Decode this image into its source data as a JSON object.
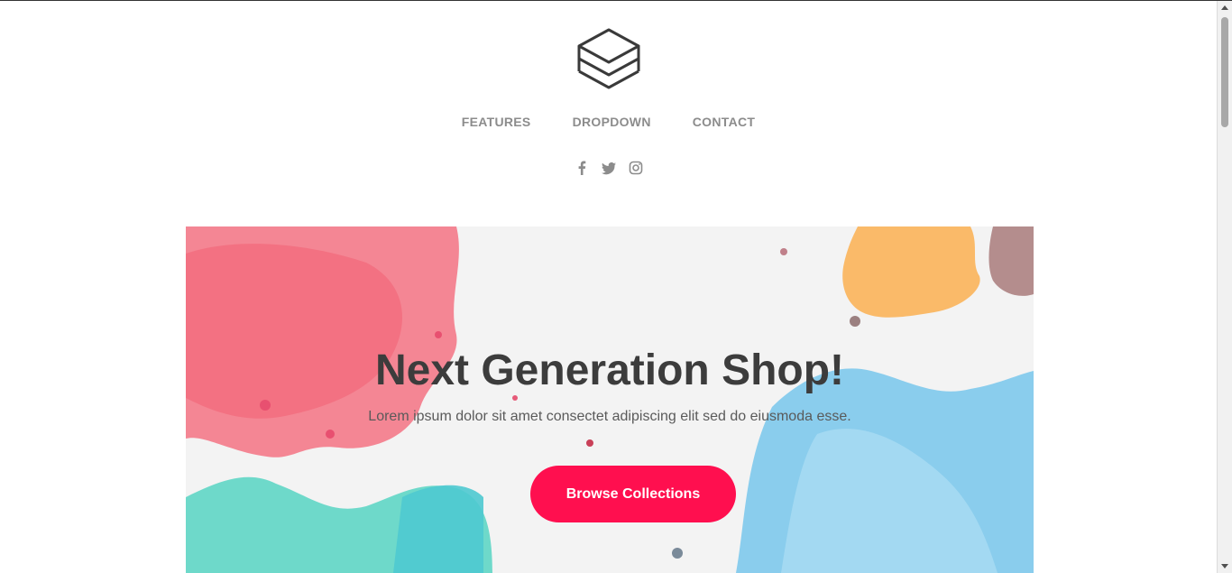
{
  "header": {
    "logo_icon": "layers-icon",
    "nav": [
      {
        "label": "FEATURES"
      },
      {
        "label": "DROPDOWN"
      },
      {
        "label": "CONTACT"
      }
    ],
    "social": [
      "facebook-icon",
      "twitter-icon",
      "instagram-icon"
    ]
  },
  "hero": {
    "title": "Next Generation Shop!",
    "subtitle": "Lorem ipsum dolor sit amet consectet adipiscing elit sed do eiusmoda esse.",
    "cta_label": "Browse Collections"
  },
  "colors": {
    "accent": "#ff0f4f",
    "nav_text": "#8c8c8c",
    "title_text": "#3c3c3c"
  }
}
